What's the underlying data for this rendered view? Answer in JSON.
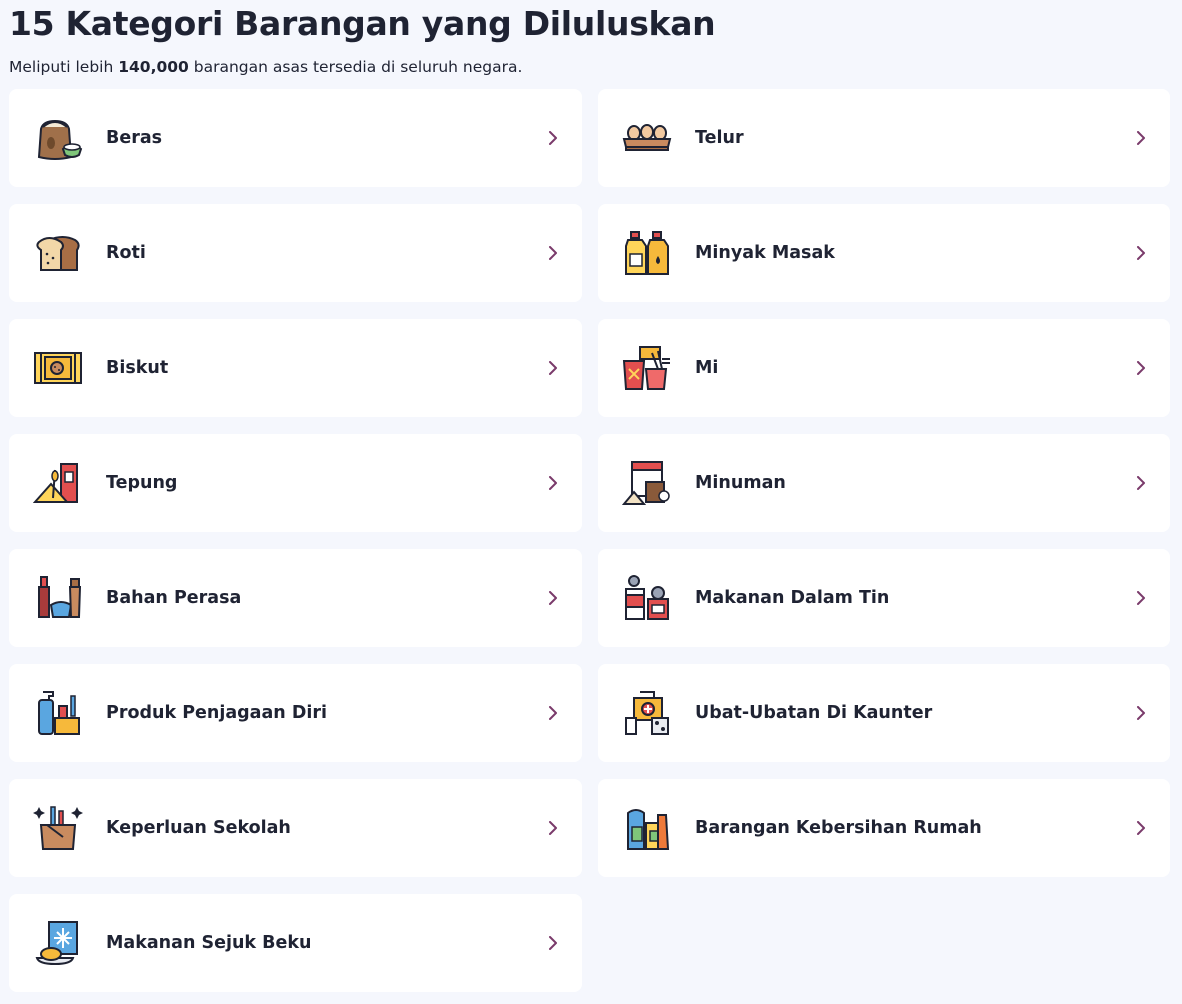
{
  "header": {
    "title": "15 Kategori Barangan yang Diluluskan",
    "subtitle_pre": "Meliputi lebih ",
    "subtitle_bold": "140,000",
    "subtitle_post": " barangan asas tersedia di seluruh negara."
  },
  "colors": {
    "chevron": "#7a3b6b",
    "card_bg": "#ffffff",
    "page_bg": "#f5f7fd"
  },
  "categories": [
    {
      "label": "Beras",
      "icon": "rice-sack-icon"
    },
    {
      "label": "Telur",
      "icon": "egg-tray-icon"
    },
    {
      "label": "Roti",
      "icon": "bread-icon"
    },
    {
      "label": "Minyak Masak",
      "icon": "cooking-oil-icon"
    },
    {
      "label": "Biskut",
      "icon": "biscuit-pack-icon"
    },
    {
      "label": "Mi",
      "icon": "noodles-icon"
    },
    {
      "label": "Tepung",
      "icon": "flour-icon"
    },
    {
      "label": "Minuman",
      "icon": "beverage-icon"
    },
    {
      "label": "Bahan Perasa",
      "icon": "seasoning-icon"
    },
    {
      "label": "Makanan Dalam Tin",
      "icon": "canned-food-icon"
    },
    {
      "label": "Produk Penjagaan Diri",
      "icon": "personal-care-icon"
    },
    {
      "label": "Ubat-Ubatan Di Kaunter",
      "icon": "medicine-icon"
    },
    {
      "label": "Keperluan Sekolah",
      "icon": "school-supplies-icon"
    },
    {
      "label": "Barangan Kebersihan Rumah",
      "icon": "household-cleaning-icon"
    },
    {
      "label": "Makanan Sejuk Beku",
      "icon": "frozen-food-icon"
    }
  ]
}
